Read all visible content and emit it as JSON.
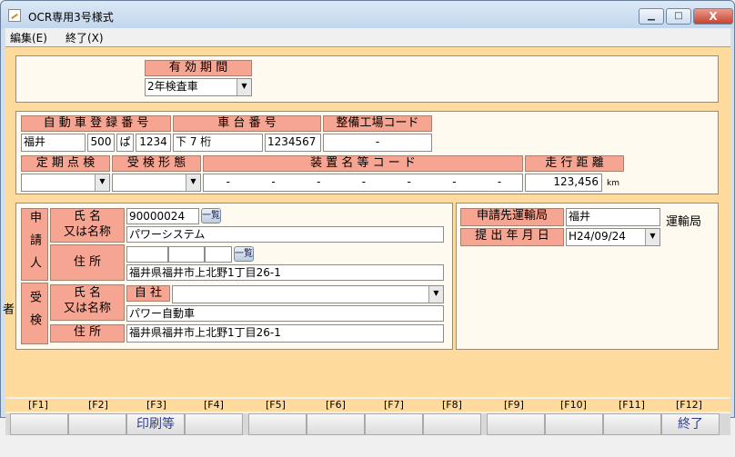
{
  "window": {
    "title": "OCR専用3号様式",
    "minimize": "▁",
    "maximize": "□",
    "close": "X"
  },
  "menu": {
    "edit": "編集(E)",
    "exit": "終了(X)"
  },
  "validity": {
    "label": "有 効 期 間",
    "value": "2年検査車"
  },
  "registration": {
    "label_no": "自 動 車 登 録 番 号",
    "label_chassis": "車 台 番 号",
    "label_shop": "整備工場コード",
    "place": "福井",
    "class": "500",
    "kana": "ぱ",
    "number": "1234",
    "chassis_prefix": "下 7 桁",
    "chassis_no": "1234567",
    "shop_code": "-"
  },
  "inspection": {
    "label_periodic": "定 期 点 検",
    "label_form": "受 検 形 態",
    "label_device": "装 置 名 等 コ ー ド",
    "label_mileage": "走 行 距 離",
    "device_codes": [
      "-",
      "-",
      "-",
      "-",
      "-",
      "-",
      "-"
    ],
    "mileage": "123,456",
    "mileage_unit": "km"
  },
  "applicant": {
    "section": "申請人",
    "name_label": "氏 名\n又は名称",
    "code": "90000024",
    "lookup": "一覧",
    "name": "パワーシステム",
    "address_label": "住 所",
    "address": "福井県福井市上北野1丁目26-1"
  },
  "examinee": {
    "section": "受検者",
    "name_label": "氏 名\n又は名称",
    "self_label": "自 社",
    "name": "パワー自動車",
    "address_label": "住 所",
    "address": "福井県福井市上北野1丁目26-1"
  },
  "office": {
    "label": "申請先運輸局",
    "value": "福井",
    "suffix": "運輸局",
    "date_label": "提 出 年 月 日",
    "date": "H24/09/24"
  },
  "fkeys": [
    "[F1]",
    "[F2]",
    "[F3]",
    "[F4]",
    "[F5]",
    "[F6]",
    "[F7]",
    "[F8]",
    "[F9]",
    "[F10]",
    "[F11]",
    "[F12]"
  ],
  "fbuttons": {
    "f3": "印刷等",
    "f12": "終了"
  }
}
